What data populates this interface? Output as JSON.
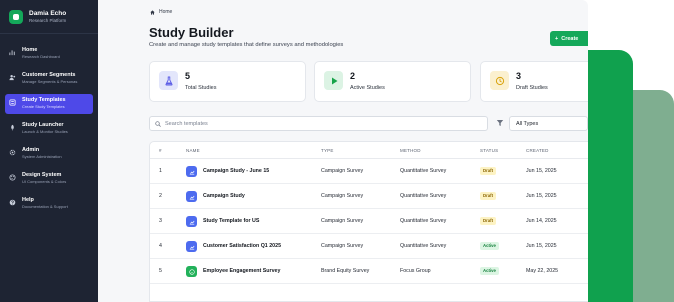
{
  "brand": {
    "title": "Damia Echo",
    "subtitle": "Research Platform",
    "accent": "#14a85a"
  },
  "sidebar": {
    "items": [
      {
        "label": "Home",
        "sub": "Research Dashboard",
        "icon": "bar-chart-icon",
        "active": false
      },
      {
        "label": "Customer Segments",
        "sub": "Manage Segments & Personas",
        "icon": "users-icon",
        "active": false
      },
      {
        "label": "Study Templates",
        "sub": "Create Study Templates",
        "icon": "template-icon",
        "active": true
      },
      {
        "label": "Study Launcher",
        "sub": "Launch & Monitor Studies",
        "icon": "rocket-icon",
        "active": false
      },
      {
        "label": "Admin",
        "sub": "System Administration",
        "icon": "gear-icon",
        "active": false
      },
      {
        "label": "Design System",
        "sub": "UI Components & Colors",
        "icon": "palette-icon",
        "active": false
      },
      {
        "label": "Help",
        "sub": "Documentation & Support",
        "icon": "help-icon",
        "active": false
      }
    ],
    "active_color": "#4e49e8"
  },
  "breadcrumb": {
    "label": "Home",
    "icon": "home-icon"
  },
  "header": {
    "title": "Study Builder",
    "subtitle": "Create and manage study templates that define surveys and methodologies",
    "create_label": "Create"
  },
  "stats": [
    {
      "value": "5",
      "label": "Total Studies",
      "icon": "flask-icon",
      "color": "#5b5ce6",
      "bg": "#e3e6fb"
    },
    {
      "value": "2",
      "label": "Active Studies",
      "icon": "play-icon",
      "color": "#17a34a",
      "bg": "#dcf3e4"
    },
    {
      "value": "3",
      "label": "Draft Studies",
      "icon": "clock-icon",
      "color": "#d9a20b",
      "bg": "#fbf0cf"
    }
  ],
  "search": {
    "placeholder": "Search templates"
  },
  "filter": {
    "selected": "All Types",
    "icon": "filter-icon"
  },
  "table": {
    "columns": [
      "#",
      "NAME",
      "TYPE",
      "METHOD",
      "STATUS",
      "CREATED"
    ],
    "rows": [
      {
        "num": "1",
        "name": "Campaign Study - June 15",
        "type": "Campaign Survey",
        "method": "Quantitative Survey",
        "status": "Draft",
        "created": "Jun 15, 2025",
        "icon": "chart-icon"
      },
      {
        "num": "2",
        "name": "Campaign Study",
        "type": "Campaign Survey",
        "method": "Quantitative Survey",
        "status": "Draft",
        "created": "Jun 15, 2025",
        "icon": "chart-icon"
      },
      {
        "num": "3",
        "name": "Study Template for US",
        "type": "Campaign Survey",
        "method": "Quantitative Survey",
        "status": "Draft",
        "created": "Jun 14, 2025",
        "icon": "chart-icon"
      },
      {
        "num": "4",
        "name": "Customer Satisfaction Q1 2025",
        "type": "Campaign Survey",
        "method": "Quantitative Survey",
        "status": "Active",
        "created": "Jun 15, 2025",
        "icon": "chart-icon"
      },
      {
        "num": "5",
        "name": "Employee Engagement Survey",
        "type": "Brand Equity Survey",
        "method": "Focus Group",
        "status": "Active",
        "created": "May 22, 2025",
        "icon": "smile-icon"
      }
    ],
    "status_colors": {
      "Draft": {
        "fg": "#8a6400",
        "bg": "#fdf3c4"
      },
      "Active": {
        "fg": "#15803d",
        "bg": "#dcf5e3"
      }
    }
  }
}
